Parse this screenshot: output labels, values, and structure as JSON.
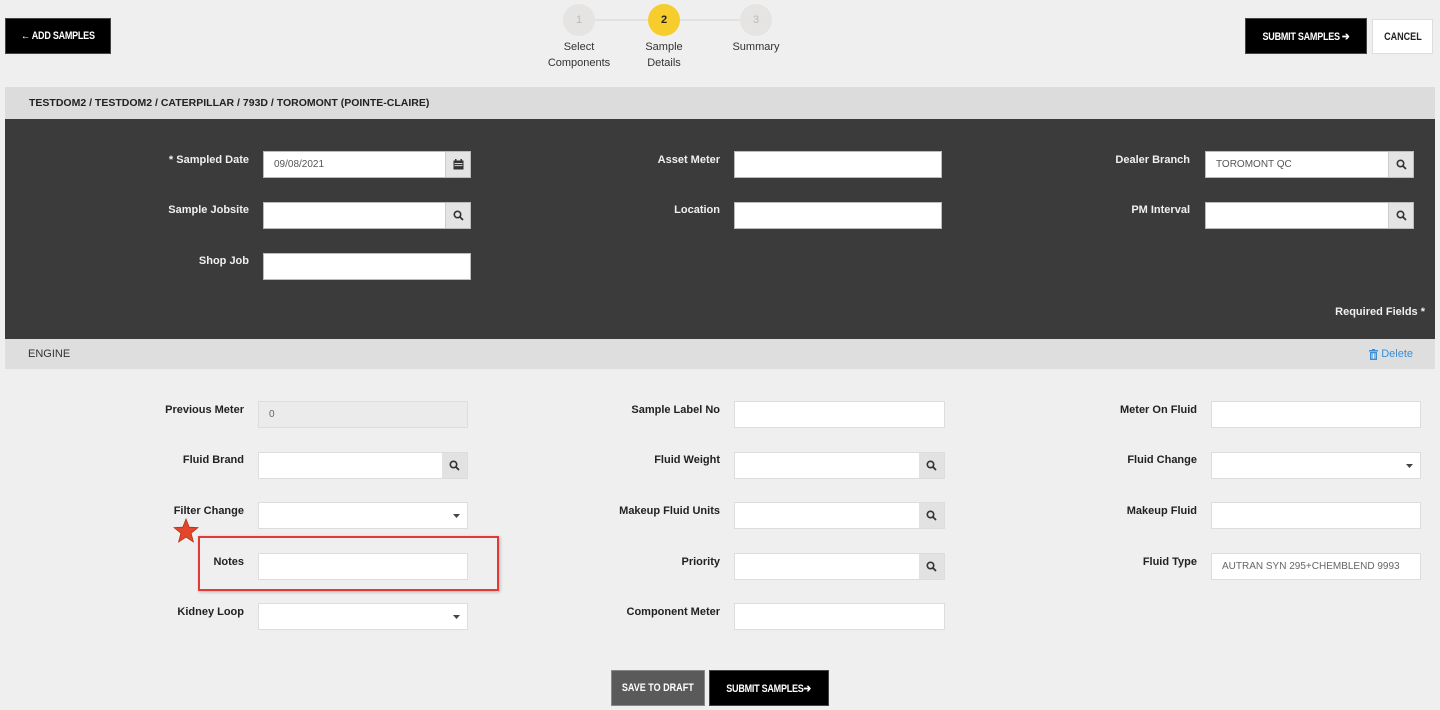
{
  "toolbar": {
    "add_samples_label": "← ADD SAMPLES",
    "submit_samples_label": "SUBMIT SAMPLES ➔",
    "cancel_label": "CANCEL"
  },
  "stepper": {
    "steps": [
      {
        "number": "1",
        "label_line1": "Select",
        "label_line2": "Components",
        "state": "inactive"
      },
      {
        "number": "2",
        "label_line1": "Sample",
        "label_line2": "Details",
        "state": "active"
      },
      {
        "number": "3",
        "label_line1": "Summary",
        "label_line2": "",
        "state": "inactive"
      }
    ],
    "active_color": "#f7cd2e"
  },
  "breadcrumb": "TESTDOM2 / TESTDOM2 / CATERPILLAR / 793D / TOROMONT (POINTE-CLAIRE)",
  "sample_header": {
    "fields": {
      "sampled_date": {
        "label": "* Sampled Date",
        "value": "09/08/2021",
        "icon": "calendar-icon"
      },
      "sample_jobsite": {
        "label": "Sample Jobsite",
        "value": "",
        "icon": "search-icon"
      },
      "shop_job": {
        "label": "Shop Job",
        "value": ""
      },
      "asset_meter": {
        "label": "Asset Meter",
        "value": ""
      },
      "location": {
        "label": "Location",
        "value": ""
      },
      "dealer_branch": {
        "label": "Dealer Branch",
        "value": "TOROMONT QC",
        "icon": "search-icon"
      },
      "pm_interval": {
        "label": "PM Interval",
        "value": "",
        "icon": "search-icon"
      }
    },
    "required_note": "Required Fields *"
  },
  "component": {
    "name": "ENGINE",
    "delete_label": "Delete",
    "fields": {
      "previous_meter": {
        "label": "Previous Meter",
        "value": "0",
        "disabled": true
      },
      "fluid_brand": {
        "label": "Fluid Brand",
        "value": "",
        "icon": "search-icon"
      },
      "filter_change": {
        "label": "Filter Change",
        "value": "",
        "type": "select"
      },
      "notes": {
        "label": "Notes",
        "value": "",
        "highlighted": true
      },
      "kidney_loop": {
        "label": "Kidney Loop",
        "value": "",
        "type": "select"
      },
      "sample_label_no": {
        "label": "Sample Label No",
        "value": ""
      },
      "fluid_weight": {
        "label": "Fluid Weight",
        "value": "",
        "icon": "search-icon"
      },
      "makeup_fluid_units": {
        "label": "Makeup Fluid Units",
        "value": "",
        "icon": "search-icon"
      },
      "priority": {
        "label": "Priority",
        "value": "",
        "icon": "search-icon"
      },
      "component_meter": {
        "label": "Component Meter",
        "value": ""
      },
      "meter_on_fluid": {
        "label": "Meter On Fluid",
        "value": ""
      },
      "fluid_change": {
        "label": "Fluid Change",
        "value": "",
        "type": "select"
      },
      "makeup_fluid": {
        "label": "Makeup Fluid",
        "value": ""
      },
      "fluid_type": {
        "label": "Fluid Type",
        "value": "AUTRAN SYN 295+CHEMBLEND 9993"
      }
    }
  },
  "footer": {
    "save_draft_label": "SAVE TO DRAFT",
    "submit_samples_label": "SUBMIT SAMPLES➔"
  },
  "colors": {
    "highlight_border": "#e03a3a",
    "star": "#e2462b",
    "link": "#3a8ed4",
    "dark_panel": "#3b3b3b"
  }
}
